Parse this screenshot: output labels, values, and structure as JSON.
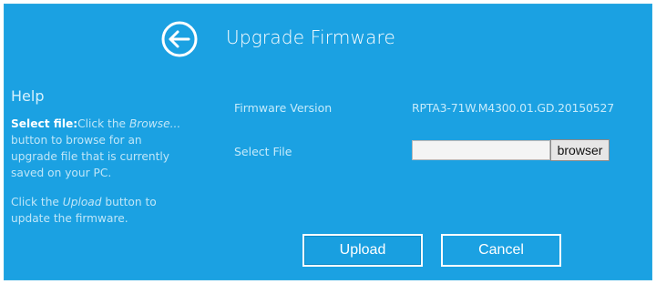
{
  "header": {
    "title": "Upgrade Firmware",
    "back_icon": "back-arrow-circle-icon"
  },
  "help": {
    "title": "Help",
    "select_file_heading": "Select file:",
    "select_file_text_1": "Click the ",
    "select_file_browse_word": "Browse...",
    "select_file_text_2": " button to browse for an upgrade file that is currently saved on your PC.",
    "upload_text_1": "Click the ",
    "upload_word": "Upload",
    "upload_text_2": " button to update the firmware."
  },
  "form": {
    "firmware_version_label": "Firmware Version",
    "firmware_version_value": "RPTA3-71W.M4300.01.GD.20150527",
    "select_file_label": "Select File",
    "select_file_value": "",
    "browse_label": "browser"
  },
  "actions": {
    "upload_label": "Upload",
    "cancel_label": "Cancel"
  },
  "colors": {
    "panel_background": "#1ba1e2",
    "text_light": "#c6ebfb",
    "button_border": "#ffffff"
  }
}
